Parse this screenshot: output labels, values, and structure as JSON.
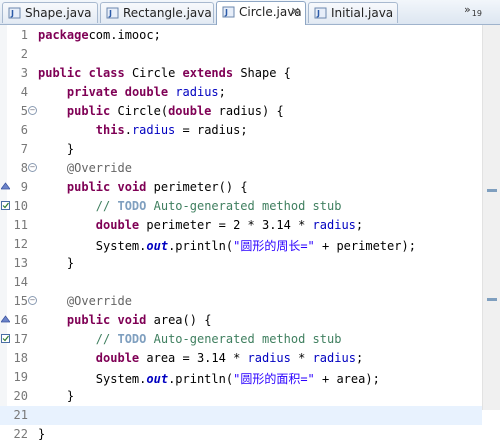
{
  "tabs": [
    {
      "label": "Shape.java",
      "active": false,
      "icon": "java-file-icon"
    },
    {
      "label": "Rectangle.java",
      "active": false,
      "icon": "java-file-icon"
    },
    {
      "label": "Circle.java",
      "active": true,
      "icon": "java-file-icon",
      "close": "✕"
    },
    {
      "label": "Initial.java",
      "active": false,
      "icon": "java-file-icon"
    }
  ],
  "overflow": {
    "symbol": "»",
    "count": "19"
  },
  "editor": {
    "current_line": 21,
    "lines": [
      {
        "num": "1",
        "tokens": [
          [
            "kw",
            "package"
          ],
          [
            "",
            "com.imooc;"
          ]
        ]
      },
      {
        "num": "2",
        "tokens": []
      },
      {
        "num": "3",
        "tokens": [
          [
            "kw",
            "public"
          ],
          [
            "",
            " "
          ],
          [
            "kw",
            "class"
          ],
          [
            "",
            " Circle "
          ],
          [
            "kw",
            "extends"
          ],
          [
            "",
            " Shape {"
          ]
        ]
      },
      {
        "num": "4",
        "tokens": [
          [
            "",
            " "
          ],
          [
            "kw",
            "private"
          ],
          [
            "",
            " "
          ],
          [
            "kw",
            "double"
          ],
          [
            "",
            " "
          ],
          [
            "fld",
            "radius"
          ],
          [
            "",
            ";"
          ]
        ]
      },
      {
        "num": "5",
        "fold": true,
        "tokens": [
          [
            "",
            " "
          ],
          [
            "kw",
            "public"
          ],
          [
            "",
            " Circle("
          ],
          [
            "kw",
            "double"
          ],
          [
            "",
            " radius) {"
          ]
        ]
      },
      {
        "num": "6",
        "tokens": [
          [
            "",
            " "
          ],
          [
            "kw",
            "this"
          ],
          [
            "",
            "."
          ],
          [
            "fld",
            "radius"
          ],
          [
            "",
            " = radius;"
          ]
        ]
      },
      {
        "num": "7",
        "tokens": [
          [
            "",
            " }"
          ]
        ]
      },
      {
        "num": "8",
        "fold": true,
        "tokens": [
          [
            "",
            " "
          ],
          [
            "ann",
            "@Override"
          ]
        ]
      },
      {
        "num": "9",
        "marker": "override",
        "tokens": [
          [
            "",
            " "
          ],
          [
            "kw",
            "public"
          ],
          [
            "",
            " "
          ],
          [
            "kw",
            "void"
          ],
          [
            "",
            " perimeter() {"
          ]
        ]
      },
      {
        "num": "10",
        "marker": "task",
        "tokens": [
          [
            "",
            " "
          ],
          [
            "cm",
            "// "
          ],
          [
            "todo",
            "TODO"
          ],
          [
            "cm",
            " Auto-generated method stub"
          ]
        ]
      },
      {
        "num": "11",
        "tokens": [
          [
            "",
            " "
          ],
          [
            "kw",
            "double"
          ],
          [
            "",
            " perimeter = 2 * 3.14 * "
          ],
          [
            "fld",
            "radius"
          ],
          [
            "",
            ";"
          ]
        ]
      },
      {
        "num": "12",
        "tokens": [
          [
            "",
            " System."
          ],
          [
            "st",
            "out"
          ],
          [
            "",
            ".println("
          ],
          [
            "str",
            "\"圆形的周长=\""
          ],
          [
            "",
            " + perimeter);"
          ]
        ]
      },
      {
        "num": "13",
        "tokens": [
          [
            "",
            " }"
          ]
        ]
      },
      {
        "num": "14",
        "tokens": []
      },
      {
        "num": "15",
        "fold": true,
        "tokens": [
          [
            "",
            " "
          ],
          [
            "ann",
            "@Override"
          ]
        ]
      },
      {
        "num": "16",
        "marker": "override",
        "tokens": [
          [
            "",
            " "
          ],
          [
            "kw",
            "public"
          ],
          [
            "",
            " "
          ],
          [
            "kw",
            "void"
          ],
          [
            "",
            " area() {"
          ]
        ]
      },
      {
        "num": "17",
        "marker": "task",
        "tokens": [
          [
            "",
            " "
          ],
          [
            "cm",
            "// "
          ],
          [
            "todo",
            "TODO"
          ],
          [
            "cm",
            " Auto-generated method stub"
          ]
        ]
      },
      {
        "num": "18",
        "tokens": [
          [
            "",
            " "
          ],
          [
            "kw",
            "double"
          ],
          [
            "",
            " area = 3.14 * "
          ],
          [
            "fld",
            "radius"
          ],
          [
            "",
            " * "
          ],
          [
            "fld",
            "radius"
          ],
          [
            "",
            ";"
          ]
        ]
      },
      {
        "num": "19",
        "tokens": [
          [
            "",
            " System."
          ],
          [
            "st",
            "out"
          ],
          [
            "",
            ".println("
          ],
          [
            "str",
            "\"圆形的面积=\""
          ],
          [
            "",
            " + area);"
          ]
        ]
      },
      {
        "num": "20",
        "tokens": [
          [
            "",
            " }"
          ]
        ]
      },
      {
        "num": "21",
        "tokens": []
      },
      {
        "num": "22",
        "tokens": [
          [
            "",
            "}"
          ]
        ]
      }
    ]
  },
  "colors": {
    "keyword": "#7f0055",
    "field": "#0000c0",
    "annotation": "#646464",
    "comment": "#3f7f5f",
    "todo": "#7f9fbf",
    "string": "#2a00ff",
    "current_line": "#e8f2fe"
  }
}
